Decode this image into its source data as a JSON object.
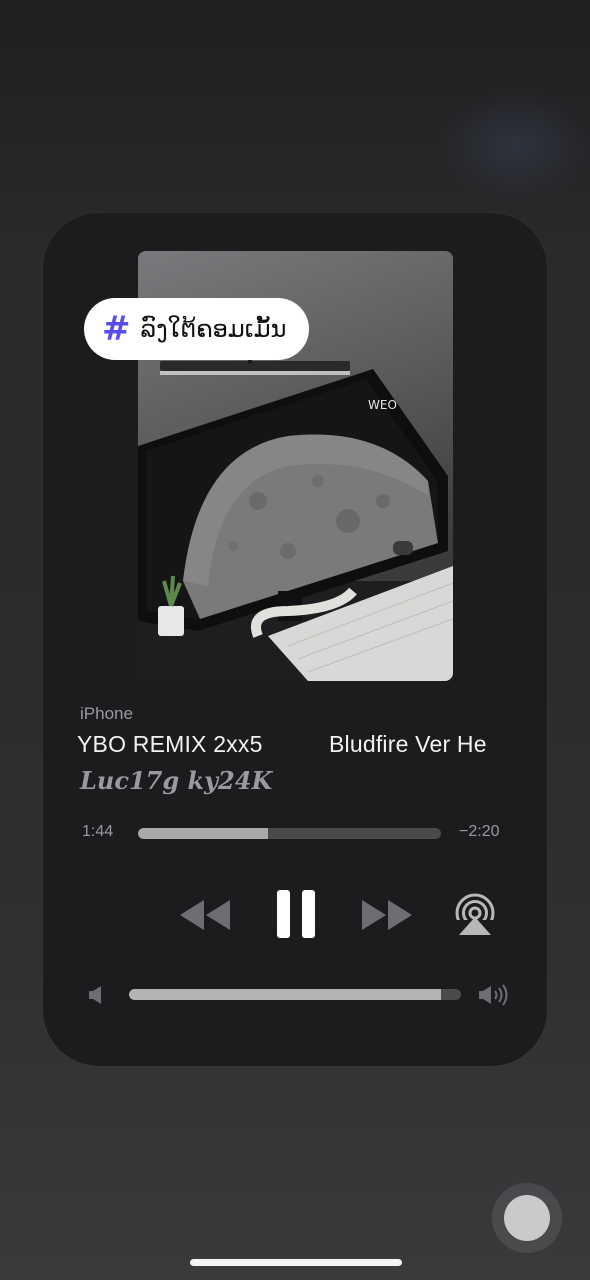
{
  "source_label": "iPhone",
  "track": {
    "title_visible_part1": "YBO REMIX 2xx5",
    "title_visible_part2": "Bludfire Ver He",
    "artist": "Luc17g ky24K"
  },
  "overlay_tag": {
    "symbol": "#",
    "text": "ລົງໃຕ້ຄອມເມັ້ນ"
  },
  "playback": {
    "elapsed": "1:44",
    "remaining": "−2:20",
    "progress_fraction": 0.43
  },
  "volume": {
    "level_fraction": 0.94
  },
  "controls": {
    "rewind_icon": "rewind-icon",
    "pause_icon": "pause-icon",
    "forward_icon": "fast-forward-icon",
    "airplay_icon": "airplay-icon"
  },
  "colors": {
    "card_background": "#1c1c1e",
    "progress_fill": "#a9a9ac",
    "track_background": "#4a4a4c",
    "hashtag_accent": "#5a4df0"
  }
}
